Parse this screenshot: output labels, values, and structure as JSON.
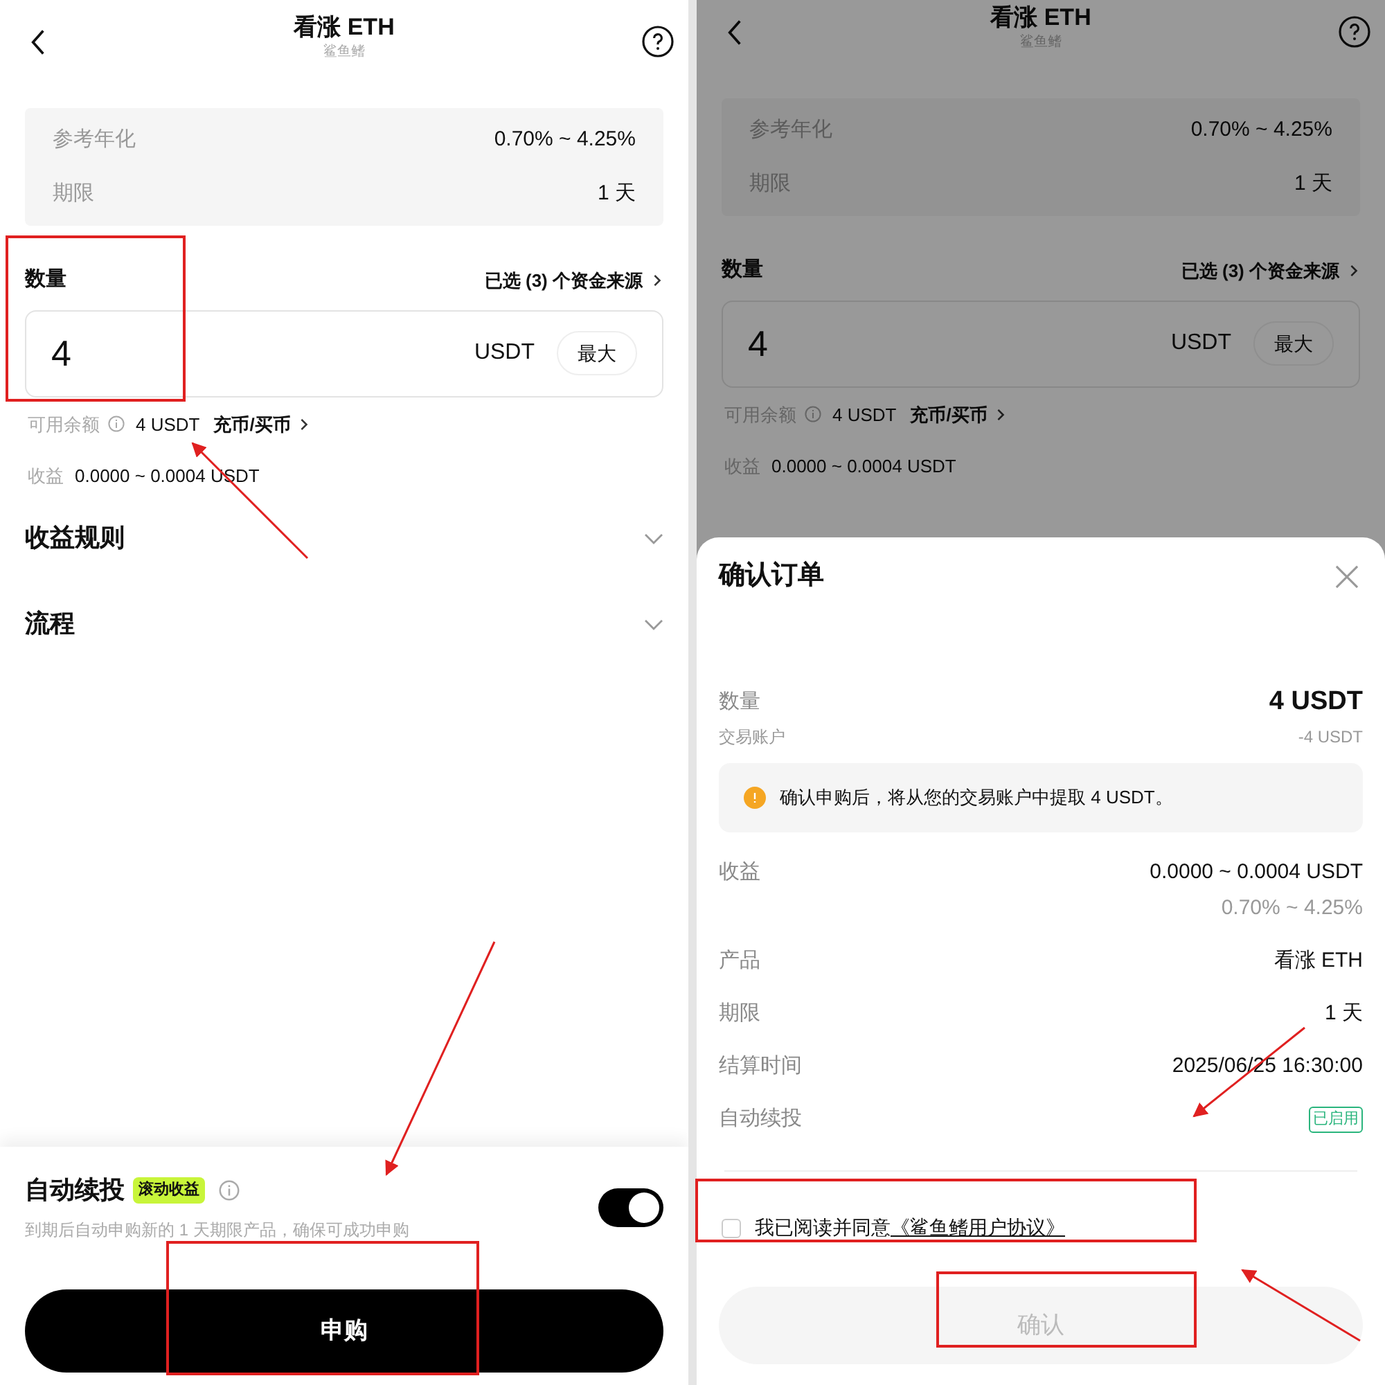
{
  "screens": [
    {
      "header": {
        "title": "看涨 ETH",
        "subtitle": "鲨鱼鳍"
      },
      "info_rows": [
        {
          "label": "参考年化",
          "value": "0.70% ~ 4.25%"
        },
        {
          "label": "期限",
          "value": "1 天"
        }
      ],
      "amount": {
        "label": "数量",
        "sources_link": "已选 (3) 个资金来源",
        "value": "4",
        "unit": "USDT",
        "max_button": "最大"
      },
      "balance": {
        "label": "可用余额",
        "value": "4 USDT",
        "link": "充币/买币"
      },
      "earnings": {
        "label": "收益",
        "value": "0.0000 ~ 0.0004 USDT"
      },
      "sections": [
        {
          "title": "收益规则",
          "expanded": false
        },
        {
          "title": "流程",
          "expanded": false
        }
      ],
      "auto_renew": {
        "title": "自动续投",
        "tag": "滚动收益",
        "description": "到期后自动申购新的 1 天期限产品，确保可成功申购",
        "on": true
      },
      "submit_button": "申购"
    },
    {
      "header": {
        "title": "看涨 ETH",
        "subtitle": "鲨鱼鳍"
      },
      "info_rows": [
        {
          "label": "参考年化",
          "value": "0.70% ~ 4.25%"
        },
        {
          "label": "期限",
          "value": "1 天"
        }
      ],
      "amount": {
        "label": "数量",
        "sources_link": "已选 (3) 个资金来源",
        "value": "4",
        "unit": "USDT",
        "max_button": "最大"
      },
      "balance": {
        "label": "可用余额",
        "value": "4 USDT",
        "link": "充币/买币"
      },
      "earnings": {
        "label": "收益",
        "value": "0.0000 ~ 0.0004 USDT"
      }
    }
  ],
  "confirm_sheet": {
    "title": "确认订单",
    "amount": {
      "label": "数量",
      "value": "4 USDT",
      "sub_label": "交易账户",
      "sub_value": "-4 USDT"
    },
    "notice": "确认申购后，将从您的交易账户中提取 4 USDT。",
    "rows": [
      {
        "kind": "text",
        "label": "收益",
        "value": "0.0000 ~ 0.0004 USDT",
        "sub_value": "0.70% ~ 4.25%"
      },
      {
        "kind": "text",
        "label": "产品",
        "value": "看涨 ETH"
      },
      {
        "kind": "text",
        "label": "期限",
        "value": "1 天"
      },
      {
        "kind": "text",
        "label": "结算时间",
        "value": "2025/06/25 16:30:00"
      },
      {
        "kind": "tag",
        "label": "自动续投",
        "value": "已启用"
      }
    ],
    "agreement": {
      "text": "我已阅读并同意",
      "link": "《鲨鱼鳍用户协议》",
      "checked": false
    },
    "confirm_button": {
      "label": "确认",
      "disabled": true
    }
  }
}
